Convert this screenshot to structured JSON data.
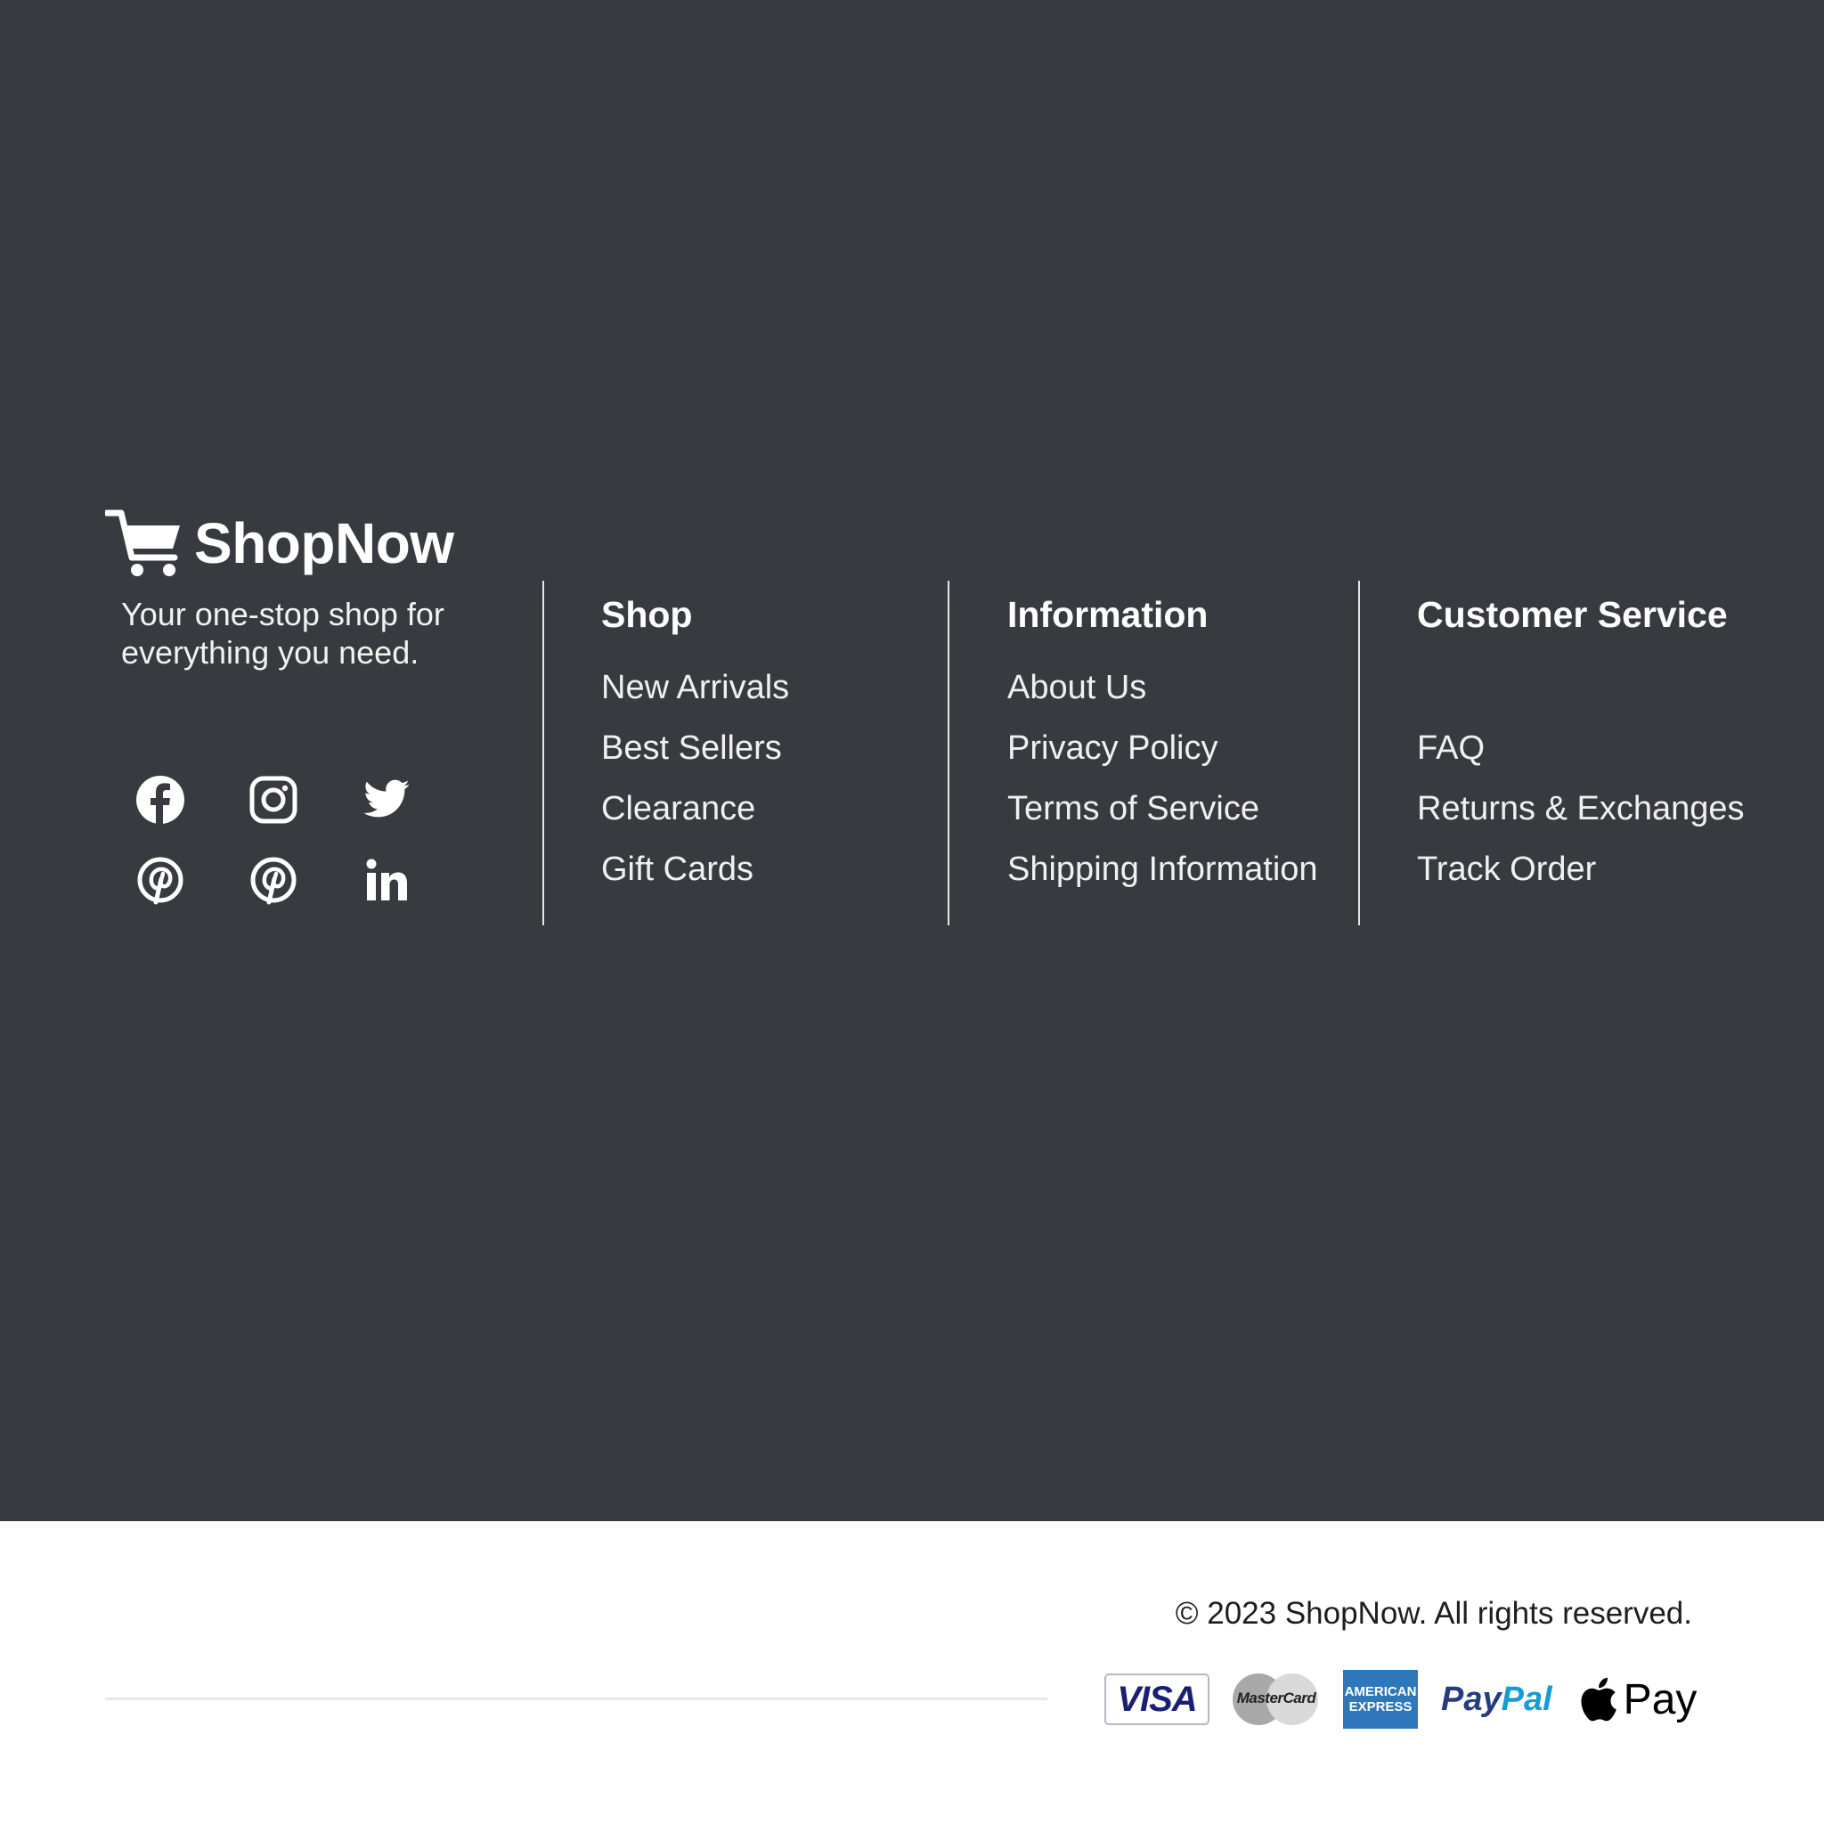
{
  "brand": {
    "name": "ShopNow",
    "tagline": "Your one-stop shop for everything you need."
  },
  "social": [
    {
      "name": "facebook-icon"
    },
    {
      "name": "instagram-icon"
    },
    {
      "name": "twitter-icon"
    },
    {
      "name": "pinterest-icon"
    },
    {
      "name": "pinterest-icon"
    },
    {
      "name": "linkedin-icon"
    }
  ],
  "columns": {
    "shop": {
      "title": "Shop",
      "links": [
        "New Arrivals",
        "Best Sellers",
        "Clearance",
        "Gift Cards"
      ]
    },
    "information": {
      "title": "Information",
      "links": [
        "About Us",
        "Privacy Policy",
        "Terms of Service",
        "Shipping Information"
      ]
    },
    "customer_service": {
      "title": "Customer Service",
      "links": [
        "FAQ",
        "Returns & Exchanges",
        "Track Order"
      ]
    }
  },
  "copyright": "© 2023 ShopNow. All rights reserved.",
  "payments": {
    "visa": "VISA",
    "mastercard": "MasterCard",
    "amex_line1": "AMERICAN",
    "amex_line2": "EXPRESS",
    "paypal_1": "Pay",
    "paypal_2": "Pal",
    "applepay": "Pay"
  },
  "colors": {
    "footer_bg": "#373a3e",
    "text": "#ffffff",
    "bottom_bg": "#ffffff"
  }
}
